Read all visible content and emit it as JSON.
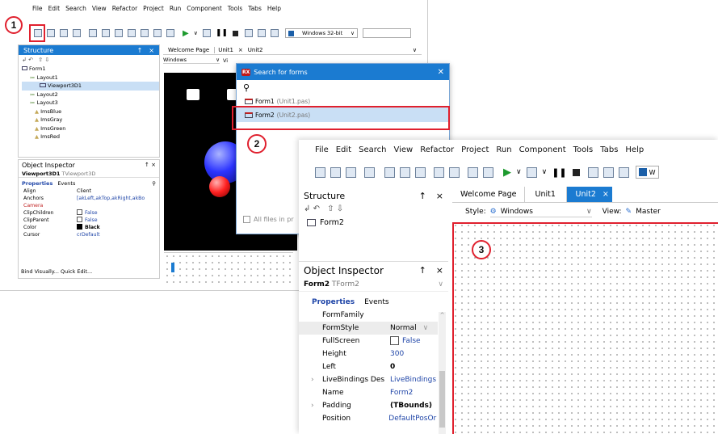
{
  "back_window": {
    "menu": [
      "File",
      "Edit",
      "Search",
      "View",
      "Refactor",
      "Project",
      "Run",
      "Component",
      "Tools",
      "Tabs",
      "Help"
    ],
    "platform_label": "Windows 32-bit",
    "structure": {
      "title": "Structure",
      "pin": "↑",
      "close": "×",
      "items": [
        "Form1",
        "Layout1",
        "Viewport3D1",
        "Layout2",
        "Layout3",
        "ImsBlue",
        "ImsGray",
        "ImsGreen",
        "ImsRed"
      ]
    },
    "tabs": [
      "Welcome Page",
      "Unit1",
      "Unit2"
    ],
    "style_select": "Windows",
    "view_label": "Vi",
    "object_inspector": {
      "title": "Object Inspector",
      "selected_name": "Viewport3D1",
      "selected_type": "TViewport3D",
      "tabs": [
        "Properties",
        "Events"
      ],
      "props": [
        {
          "name": "Align",
          "value": "Client"
        },
        {
          "name": "Anchors",
          "value": "[akLeft,akTop,akRight,akBo"
        },
        {
          "name": "Camera",
          "value": ""
        },
        {
          "name": "ClipChildren",
          "value": "False"
        },
        {
          "name": "ClipParent",
          "value": "False"
        },
        {
          "name": "Color",
          "value": "Black"
        },
        {
          "name": "Cursor",
          "value": "crDefault"
        }
      ],
      "footer": "Bind Visually... Quick Edit..."
    }
  },
  "dialog": {
    "title": "Search for forms",
    "logo": "RX",
    "close": "✕",
    "items": [
      {
        "name": "Form1",
        "unit": "(Unit1.pas)"
      },
      {
        "name": "Form2",
        "unit": "(Unit2.pas)"
      }
    ],
    "all_files_label": "All files in pr"
  },
  "front_window": {
    "menu": [
      "File",
      "Edit",
      "Search",
      "View",
      "Refactor",
      "Project",
      "Run",
      "Component",
      "Tools",
      "Tabs",
      "Help"
    ],
    "platform_label": "W",
    "structure": {
      "title": "Structure",
      "pin": "↑",
      "close": "×",
      "item": "Form2"
    },
    "tabs": [
      "Welcome Page",
      "Unit1",
      "Unit2"
    ],
    "style_label": "Style:",
    "style_value": "Windows",
    "view_label": "View:",
    "view_value": "Master",
    "object_inspector": {
      "title": "Object Inspector",
      "pin": "↑",
      "close": "×",
      "selected_name": "Form2",
      "selected_type": "TForm2",
      "tabs": [
        "Properties",
        "Events"
      ],
      "props": [
        {
          "name": "FormFamily",
          "value": ""
        },
        {
          "name": "FormStyle",
          "value": "Normal"
        },
        {
          "name": "FullScreen",
          "value": "False"
        },
        {
          "name": "Height",
          "value": "300"
        },
        {
          "name": "Left",
          "value": "0"
        },
        {
          "name": "LiveBindings Des",
          "value": "LiveBindings"
        },
        {
          "name": "Name",
          "value": "Form2"
        },
        {
          "name": "Padding",
          "value": "(TBounds)"
        },
        {
          "name": "Position",
          "value": "DefaultPosOr"
        }
      ]
    }
  },
  "annotations": [
    "1",
    "2",
    "3"
  ],
  "colors": {
    "accent": "#1b7bd1",
    "annotation": "#e0202e",
    "selection": "#c9dff5"
  }
}
